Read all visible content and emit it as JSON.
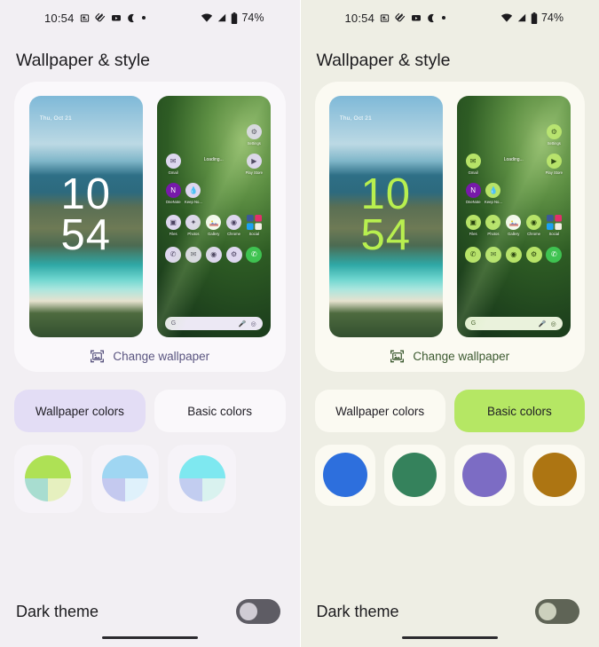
{
  "panels": [
    {
      "id": "left-panel",
      "theme": "wallpaper-colors",
      "background": "#f2eff3",
      "statusbar": {
        "time": "10:54",
        "icons": [
          "news-icon",
          "clipboard-icon",
          "youtube-icon",
          "crescent-moon-icon",
          "dot-icon"
        ],
        "wifi": "wifi-icon",
        "signal": "signal-icon",
        "battery_icon": "battery-icon",
        "battery": "74%"
      },
      "title": "Wallpaper & style",
      "lock_preview": {
        "date": "Thu, Oct 21",
        "hours": "10",
        "minutes": "54",
        "clock_color": "#ffffff"
      },
      "home_preview": {
        "loading_text": "Loading...",
        "apps": [
          {
            "label": "Settings",
            "icon": "settings-gear-icon"
          },
          {
            "label": "Gmail",
            "icon": "gmail-icon"
          },
          {
            "label": "Play Store",
            "icon": "play-store-icon"
          },
          {
            "label": "OneNote",
            "icon": "onenote-icon"
          },
          {
            "label": "Keep No...",
            "icon": "keep-notes-icon"
          },
          {
            "label": "Files",
            "icon": "files-icon"
          },
          {
            "label": "Photos",
            "icon": "photos-icon"
          },
          {
            "label": "Gallery",
            "icon": "gallery-icon"
          },
          {
            "label": "Chrome",
            "icon": "chrome-icon"
          },
          {
            "label": "Social",
            "icon": "social-folder-icon"
          }
        ],
        "dock": [
          "phone-icon",
          "messages-icon",
          "camera-icon",
          "settings-gear-icon",
          "whatsapp-icon"
        ],
        "search": {
          "logo": "google-g-icon",
          "mic": "microphone-icon",
          "lens": "google-lens-icon"
        },
        "icon_tint": "#ded7ef"
      },
      "change_wallpaper": {
        "label": "Change wallpaper",
        "icon": "image-frame-icon",
        "color": "#5a5580"
      },
      "tabs": [
        {
          "label": "Wallpaper colors",
          "selected": true,
          "color": "#e3ddf5"
        },
        {
          "label": "Basic colors",
          "selected": false,
          "color": "#faf8fb"
        }
      ],
      "swatch_type": "quadrant",
      "swatches": [
        {
          "name": "swatch-green-yellow",
          "quadrants": [
            "#aee155",
            "#aee155",
            "#a8ddd0",
            "#e6f0bf"
          ]
        },
        {
          "name": "swatch-light-blue",
          "quadrants": [
            "#9fd6f2",
            "#9fd6f2",
            "#c4c9ef",
            "#dff1fb"
          ]
        },
        {
          "name": "swatch-cyan",
          "quadrants": [
            "#7ee8f0",
            "#7ee8f0",
            "#c2cdf0",
            "#d9f2ef"
          ]
        }
      ],
      "dark_theme": {
        "label": "Dark theme",
        "enabled": false,
        "track": "#5e5c64",
        "knob": "#d0ccd4"
      }
    },
    {
      "id": "right-panel",
      "theme": "basic-colors",
      "background": "#eeeee4",
      "statusbar": {
        "time": "10:54",
        "icons": [
          "news-icon",
          "clipboard-icon",
          "youtube-icon",
          "crescent-moon-icon",
          "dot-icon"
        ],
        "wifi": "wifi-icon",
        "signal": "signal-icon",
        "battery_icon": "battery-icon",
        "battery": "74%"
      },
      "title": "Wallpaper & style",
      "lock_preview": {
        "date": "Thu, Oct 21",
        "hours": "10",
        "minutes": "54",
        "clock_color": "#b8ef4f"
      },
      "home_preview": {
        "loading_text": "Loading...",
        "apps": [
          {
            "label": "Settings",
            "icon": "settings-gear-icon"
          },
          {
            "label": "Gmail",
            "icon": "gmail-icon"
          },
          {
            "label": "Play Store",
            "icon": "play-store-icon"
          },
          {
            "label": "OneNote",
            "icon": "onenote-icon"
          },
          {
            "label": "Keep No...",
            "icon": "keep-notes-icon"
          },
          {
            "label": "Files",
            "icon": "files-icon"
          },
          {
            "label": "Photos",
            "icon": "photos-icon"
          },
          {
            "label": "Gallery",
            "icon": "gallery-icon"
          },
          {
            "label": "Chrome",
            "icon": "chrome-icon"
          },
          {
            "label": "Social",
            "icon": "social-folder-icon"
          }
        ],
        "dock": [
          "phone-icon",
          "messages-icon",
          "camera-icon",
          "settings-gear-icon",
          "whatsapp-icon"
        ],
        "search": {
          "logo": "google-g-icon",
          "mic": "microphone-icon",
          "lens": "google-lens-icon"
        },
        "icon_tint": "#b7e368"
      },
      "change_wallpaper": {
        "label": "Change wallpaper",
        "icon": "image-frame-icon",
        "color": "#3c5a30"
      },
      "tabs": [
        {
          "label": "Wallpaper colors",
          "selected": false,
          "color": "#fbfaf2"
        },
        {
          "label": "Basic colors",
          "selected": true,
          "color": "#b5e764"
        }
      ],
      "swatch_type": "solid",
      "swatches": [
        {
          "name": "swatch-blue",
          "color": "#2d6fdd"
        },
        {
          "name": "swatch-green",
          "color": "#35825c"
        },
        {
          "name": "swatch-purple",
          "color": "#7c6cc4"
        },
        {
          "name": "swatch-brown",
          "color": "#ad7512"
        }
      ],
      "dark_theme": {
        "label": "Dark theme",
        "enabled": false,
        "track": "#5f6456",
        "knob": "#ccd0bd"
      }
    }
  ]
}
